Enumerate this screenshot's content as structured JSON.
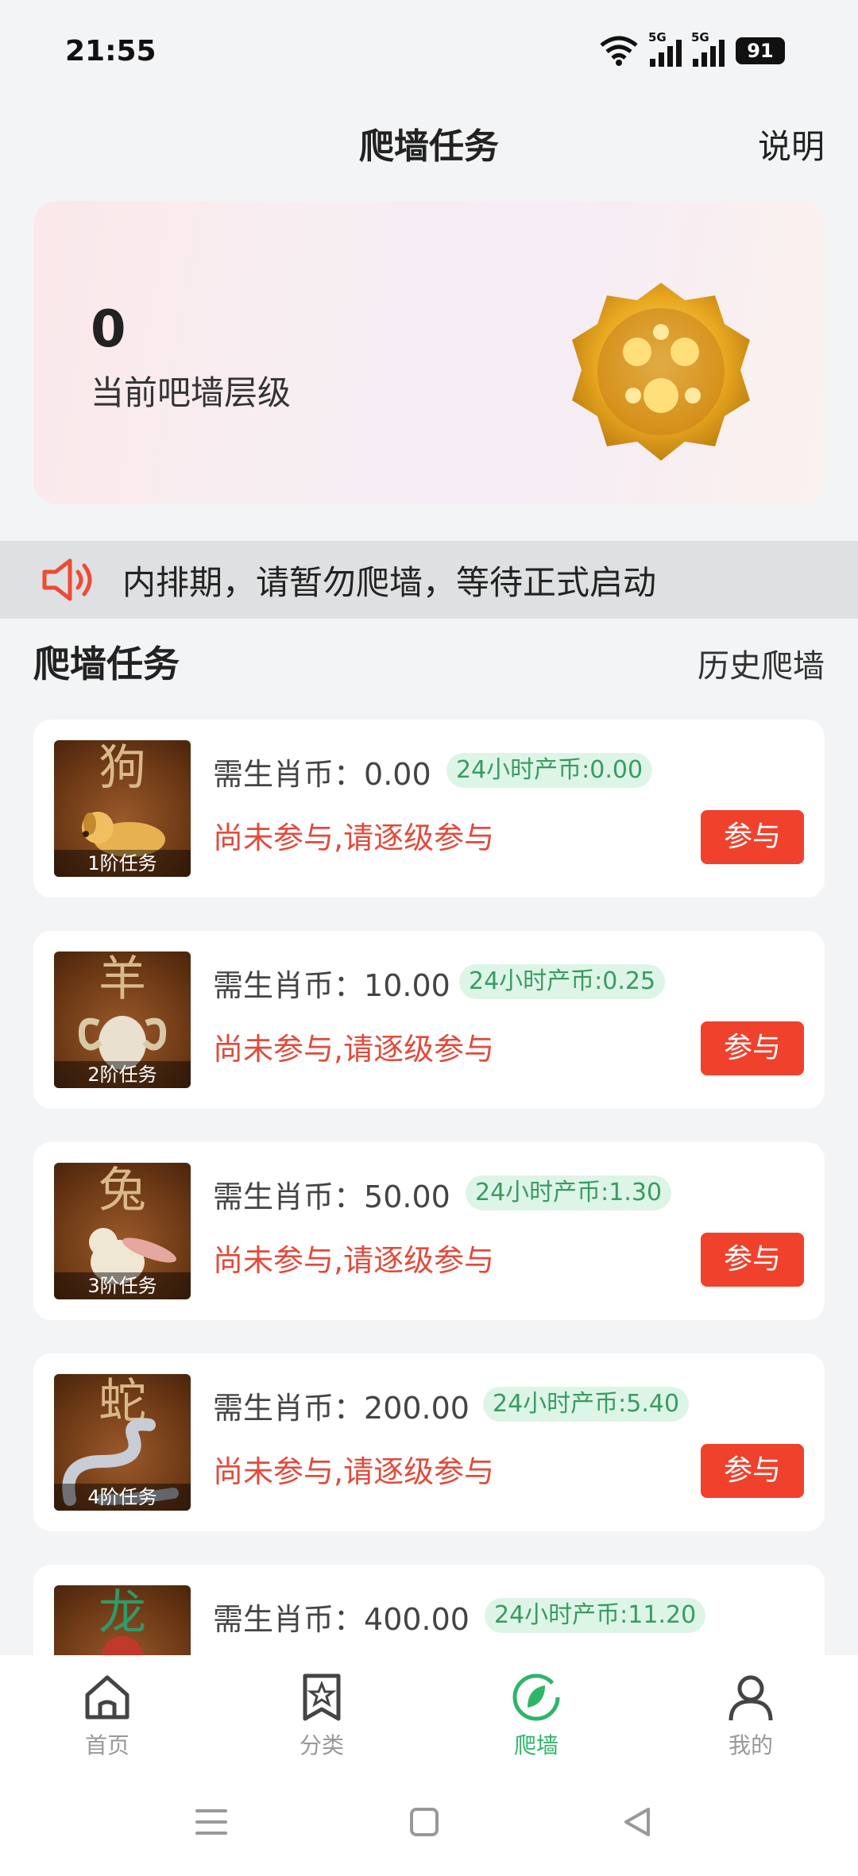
{
  "status_bar": {
    "time": "21:55",
    "battery": "91",
    "net1": "5G",
    "net2": "5G"
  },
  "header": {
    "title": "爬墙任务",
    "explain": "说明"
  },
  "level_card": {
    "value": "0",
    "label": "当前吧墙层级"
  },
  "notice": {
    "text": "内排期，请暂勿爬墙，等待正式启动"
  },
  "section": {
    "title": "爬墙任务",
    "history": "历史爬墙"
  },
  "tasks": [
    {
      "zodiac": "狗",
      "tier": "1阶任务",
      "cost_prefix": "需生肖币：",
      "cost": "0.00",
      "yield": "24小时产币:0.00",
      "status": "尚未参与,请逐级参与",
      "button": "参与"
    },
    {
      "zodiac": "羊",
      "tier": "2阶任务",
      "cost_prefix": "需生肖币：",
      "cost": "10.00",
      "yield": "24小时产币:0.25",
      "status": "尚未参与,请逐级参与",
      "button": "参与"
    },
    {
      "zodiac": "兔",
      "tier": "3阶任务",
      "cost_prefix": "需生肖币：",
      "cost": "50.00",
      "yield": "24小时产币:1.30",
      "status": "尚未参与,请逐级参与",
      "button": "参与"
    },
    {
      "zodiac": "蛇",
      "tier": "4阶任务",
      "cost_prefix": "需生肖币：",
      "cost": "200.00",
      "yield": "24小时产币:5.40",
      "status": "尚未参与,请逐级参与",
      "button": "参与"
    },
    {
      "zodiac": "龙",
      "tier": "",
      "cost_prefix": "需生肖币：",
      "cost": "400.00",
      "yield": "24小时产币:11.20",
      "status": "",
      "button": ""
    }
  ],
  "tabs": [
    {
      "label": "首页",
      "icon": "home-icon",
      "active": false
    },
    {
      "label": "分类",
      "icon": "category-icon",
      "active": false
    },
    {
      "label": "爬墙",
      "icon": "climb-icon",
      "active": true
    },
    {
      "label": "我的",
      "icon": "profile-icon",
      "active": false
    }
  ],
  "colors": {
    "accent_green": "#2fb56a",
    "accent_red": "#f0412d",
    "badge_bg": "#ddf5e7"
  }
}
